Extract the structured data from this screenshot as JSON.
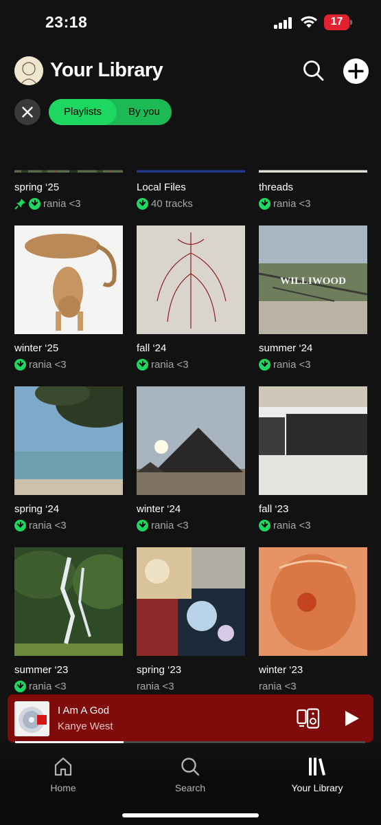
{
  "status_bar": {
    "time": "23:18",
    "battery": "17"
  },
  "header": {
    "title": "Your Library"
  },
  "filters": {
    "chips": [
      "Playlists",
      "By you"
    ],
    "active": "Playlists"
  },
  "items": [
    {
      "title": "spring ‘25",
      "subtitle": "rania <3",
      "downloaded": true,
      "pinned": true
    },
    {
      "title": "Local Files",
      "subtitle": "40 tracks",
      "downloaded": true,
      "pinned": false
    },
    {
      "title": "threads",
      "subtitle": "rania <3",
      "downloaded": true,
      "pinned": false
    },
    {
      "title": "winter ‘25",
      "subtitle": "rania <3",
      "downloaded": true,
      "pinned": false
    },
    {
      "title": "fall ‘24",
      "subtitle": "rania <3",
      "downloaded": true,
      "pinned": false
    },
    {
      "title": "summer ‘24",
      "subtitle": "rania <3",
      "downloaded": true,
      "pinned": false
    },
    {
      "title": "spring ‘24",
      "subtitle": "rania <3",
      "downloaded": true,
      "pinned": false
    },
    {
      "title": "winter ‘24",
      "subtitle": "rania <3",
      "downloaded": true,
      "pinned": false
    },
    {
      "title": "fall ‘23",
      "subtitle": "rania <3",
      "downloaded": true,
      "pinned": false
    },
    {
      "title": "summer ‘23",
      "subtitle": "rania <3",
      "downloaded": true,
      "pinned": false
    },
    {
      "title": "spring ‘23",
      "subtitle": "rania <3",
      "downloaded": false,
      "pinned": false
    },
    {
      "title": "winter ‘23",
      "subtitle": "rania <3",
      "downloaded": false,
      "pinned": false
    }
  ],
  "artwork_text": {
    "summer24": "WILLIWOOD"
  },
  "now_playing": {
    "title": "I Am A God",
    "artist": "Kanye West",
    "progress": 0.31,
    "background": "#7f0b0b"
  },
  "tabs": [
    {
      "label": "Home",
      "icon": "home-icon"
    },
    {
      "label": "Search",
      "icon": "search-icon"
    },
    {
      "label": "Your Library",
      "icon": "library-icon",
      "active": true
    }
  ],
  "colors": {
    "accent": "#1ed760",
    "background": "#121212"
  }
}
